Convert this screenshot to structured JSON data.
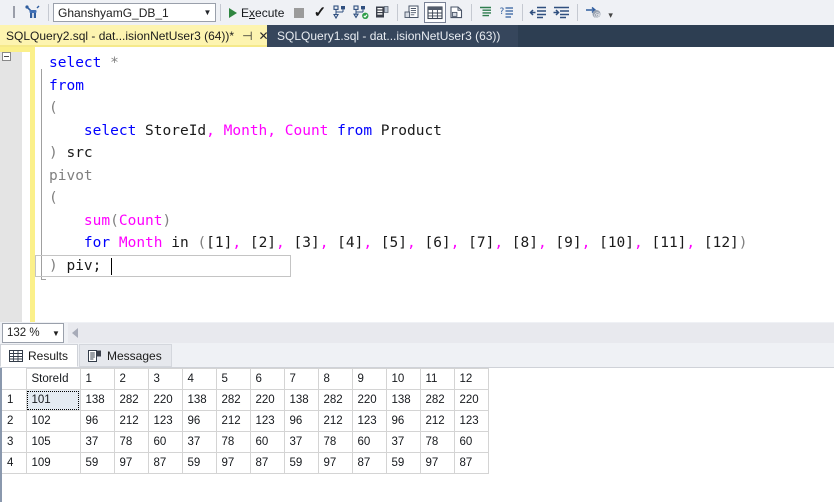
{
  "toolbar": {
    "database": "GhanshyamG_DB_1",
    "database_dropdown_arrow": "▼",
    "execute_label_pre": "E",
    "execute_label_underlined": "x",
    "execute_label_post": "ecute",
    "overflow_label": "▾",
    "icons": [
      "debug-icon",
      "new-query-icon",
      "play-icon",
      "stop-icon",
      "parse-checkmark-icon",
      "display-estimated-execution-plan-icon",
      "include-actual-execution-plan-icon",
      "include-client-statistics-icon",
      "results-to-text-icon",
      "results-to-grid-icon",
      "results-to-file-icon",
      "comment-lines-icon",
      "uncomment-lines-icon",
      "decrease-indent-icon",
      "increase-indent-icon",
      "specify-values-for-template-parameters-icon"
    ]
  },
  "tabs": [
    {
      "title": "SQLQuery2.sql - dat...isionNetUser3 (64))*",
      "pin": "⊣",
      "close": "✕",
      "active": true
    },
    {
      "title": "SQLQuery1.sql - dat...isionNetUser3 (63))",
      "active": false
    }
  ],
  "editor": {
    "zoom": "132 %",
    "zoom_dropdown_arrow": "▼",
    "lines": [
      [
        {
          "t": "select",
          "c": "kw"
        },
        {
          "t": " ",
          "c": "blk"
        },
        {
          "t": "*",
          "c": "gry"
        }
      ],
      [
        {
          "t": "from",
          "c": "kw"
        }
      ],
      [
        {
          "t": "(",
          "c": "gry"
        }
      ],
      [
        {
          "t": "    ",
          "c": "blk"
        },
        {
          "t": "select",
          "c": "kw"
        },
        {
          "t": " StoreId",
          "c": "blk"
        },
        {
          "t": ",",
          "c": "mag"
        },
        {
          "t": " ",
          "c": "blk"
        },
        {
          "t": "Month",
          "c": "mag"
        },
        {
          "t": ",",
          "c": "mag"
        },
        {
          "t": " ",
          "c": "blk"
        },
        {
          "t": "Count",
          "c": "mag"
        },
        {
          "t": " ",
          "c": "blk"
        },
        {
          "t": "from",
          "c": "kw"
        },
        {
          "t": " Product",
          "c": "blk"
        }
      ],
      [
        {
          "t": ")",
          "c": "gry"
        },
        {
          "t": " src",
          "c": "blk"
        }
      ],
      [
        {
          "t": "pivot",
          "c": "gry"
        }
      ],
      [
        {
          "t": "(",
          "c": "gry"
        }
      ],
      [
        {
          "t": "    ",
          "c": "blk"
        },
        {
          "t": "sum",
          "c": "mag"
        },
        {
          "t": "(",
          "c": "gry"
        },
        {
          "t": "Count",
          "c": "mag"
        },
        {
          "t": ")",
          "c": "gry"
        }
      ],
      [
        {
          "t": "    ",
          "c": "blk"
        },
        {
          "t": "for",
          "c": "kw"
        },
        {
          "t": " ",
          "c": "blk"
        },
        {
          "t": "Month",
          "c": "mag"
        },
        {
          "t": " in ",
          "c": "blk"
        },
        {
          "t": "(",
          "c": "gry"
        },
        {
          "t": "[1]",
          "c": "blk"
        },
        {
          "t": ",",
          "c": "mag"
        },
        {
          "t": " [2]",
          "c": "blk"
        },
        {
          "t": ",",
          "c": "mag"
        },
        {
          "t": " [3]",
          "c": "blk"
        },
        {
          "t": ",",
          "c": "mag"
        },
        {
          "t": " [4]",
          "c": "blk"
        },
        {
          "t": ",",
          "c": "mag"
        },
        {
          "t": " [5]",
          "c": "blk"
        },
        {
          "t": ",",
          "c": "mag"
        },
        {
          "t": " [6]",
          "c": "blk"
        },
        {
          "t": ",",
          "c": "mag"
        },
        {
          "t": " [7]",
          "c": "blk"
        },
        {
          "t": ",",
          "c": "mag"
        },
        {
          "t": " [8]",
          "c": "blk"
        },
        {
          "t": ",",
          "c": "mag"
        },
        {
          "t": " [9]",
          "c": "blk"
        },
        {
          "t": ",",
          "c": "mag"
        },
        {
          "t": " [10]",
          "c": "blk"
        },
        {
          "t": ",",
          "c": "mag"
        },
        {
          "t": " [11]",
          "c": "blk"
        },
        {
          "t": ",",
          "c": "mag"
        },
        {
          "t": " [12]",
          "c": "blk"
        },
        {
          "t": ")",
          "c": "gry"
        }
      ],
      [
        {
          "t": ")",
          "c": "gry"
        },
        {
          "t": " piv;",
          "c": "blk"
        }
      ]
    ]
  },
  "result_tabs": [
    {
      "label": "Results",
      "icon": "grid-icon",
      "selected": true
    },
    {
      "label": "Messages",
      "icon": "messages-icon",
      "selected": false
    }
  ],
  "grid": {
    "columns": [
      "StoreId",
      "1",
      "2",
      "3",
      "4",
      "5",
      "6",
      "7",
      "8",
      "9",
      "10",
      "11",
      "12"
    ],
    "row_numbers": [
      "1",
      "2",
      "3",
      "4"
    ],
    "rows": [
      [
        "101",
        "138",
        "282",
        "220",
        "138",
        "282",
        "220",
        "138",
        "282",
        "220",
        "138",
        "282",
        "220"
      ],
      [
        "102",
        "96",
        "212",
        "123",
        "96",
        "212",
        "123",
        "96",
        "212",
        "123",
        "96",
        "212",
        "123"
      ],
      [
        "105",
        "37",
        "78",
        "60",
        "37",
        "78",
        "60",
        "37",
        "78",
        "60",
        "37",
        "78",
        "60"
      ],
      [
        "109",
        "59",
        "97",
        "87",
        "59",
        "97",
        "87",
        "59",
        "97",
        "87",
        "59",
        "97",
        "87"
      ]
    ],
    "selected_cell": {
      "row": 0,
      "col": 0
    }
  },
  "colors": {
    "tab_active_bg": "#fdf4b0",
    "tab_strip_bg": "#2d3e52",
    "toolbar_bg": "#eff1f5",
    "keyword_blue": "#0000ff",
    "identifier_magenta": "#ff00ff",
    "operator_gray": "#808080",
    "change_bar_yellow": "#fbf08a",
    "execute_green": "#2e8540",
    "grid_selection": "#e4ebf2"
  }
}
